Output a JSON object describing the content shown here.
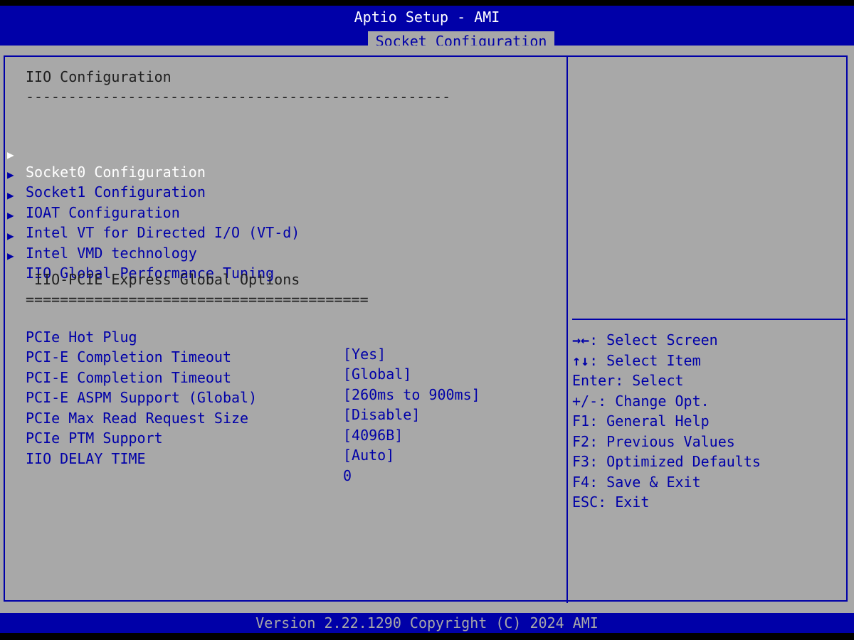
{
  "header": {
    "title": "Aptio Setup - AMI",
    "active_tab": "Socket Configuration"
  },
  "main": {
    "section_title": "IIO Configuration",
    "section_rule": "--------------------------------------------------",
    "submenus": [
      {
        "label": "Socket0 Configuration",
        "selected": true
      },
      {
        "label": "Socket1 Configuration",
        "selected": false
      },
      {
        "label": "IOAT Configuration",
        "selected": false
      },
      {
        "label": "Intel VT for Directed I/O (VT-d)",
        "selected": false
      },
      {
        "label": "Intel VMD technology",
        "selected": false
      },
      {
        "label": "IIO Global Performance Tuning",
        "selected": false
      }
    ],
    "options_title": "IIO-PCIE Express Global Options",
    "options_rule": "========================================",
    "options": [
      {
        "label": "PCIe Hot Plug",
        "value": "[Yes]"
      },
      {
        "label": "PCI-E Completion Timeout",
        "value": "[Global]"
      },
      {
        "label": "PCI-E Completion Timeout",
        "value": "[260ms to 900ms]"
      },
      {
        "label": "PCI-E ASPM Support (Global)",
        "value": "[Disable]"
      },
      {
        "label": "PCIe Max Read Request Size",
        "value": "[4096B]"
      },
      {
        "label": "PCIe PTM Support",
        "value": "[Auto]"
      },
      {
        "label": "IIO DELAY TIME",
        "value": "0"
      }
    ]
  },
  "help": {
    "keys": [
      {
        "key": "→←",
        "text": ": Select Screen"
      },
      {
        "key": "↑↓",
        "text": ": Select Item"
      },
      {
        "key": "",
        "text": "Enter: Select"
      },
      {
        "key": "",
        "text": "+/-: Change Opt."
      },
      {
        "key": "",
        "text": "F1: General Help"
      },
      {
        "key": "",
        "text": "F2: Previous Values"
      },
      {
        "key": "",
        "text": "F3: Optimized Defaults"
      },
      {
        "key": "",
        "text": "F4: Save & Exit"
      },
      {
        "key": "",
        "text": "ESC: Exit"
      }
    ]
  },
  "footer": {
    "version": "Version 2.22.1290 Copyright (C) 2024 AMI"
  },
  "colors": {
    "background": "#a8a8a8",
    "bar": "#0000a8",
    "selected_text": "#ffffff",
    "label_text": "#0000a8"
  }
}
